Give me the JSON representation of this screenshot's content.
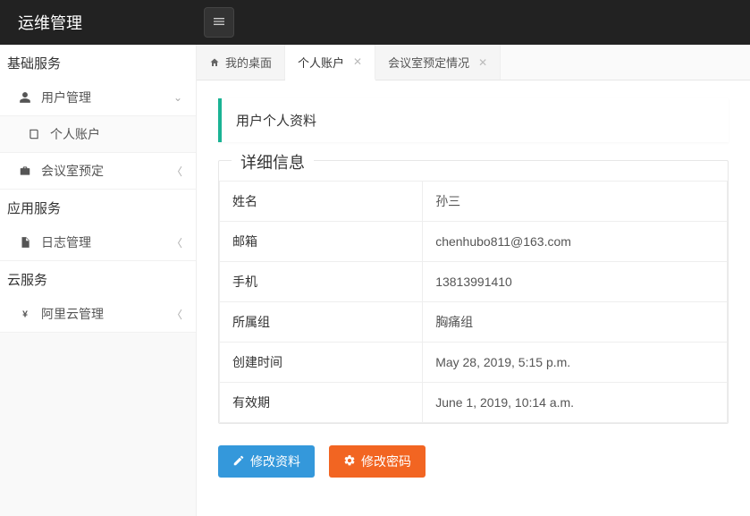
{
  "brand": "运维管理",
  "sidebar": {
    "groups": [
      {
        "header": "基础服务",
        "items": [
          {
            "icon": "user",
            "label": "用户管理",
            "chev": "down",
            "children": [
              {
                "icon": "book",
                "label": "个人账户"
              }
            ]
          },
          {
            "icon": "briefcase",
            "label": "会议室预定",
            "chev": "left"
          }
        ]
      },
      {
        "header": "应用服务",
        "items": [
          {
            "icon": "file",
            "label": "日志管理",
            "chev": "left"
          }
        ]
      },
      {
        "header": "云服务",
        "items": [
          {
            "icon": "yen",
            "label": "阿里云管理",
            "chev": "left"
          }
        ]
      }
    ]
  },
  "tabs": [
    {
      "icon": "home",
      "label": "我的桌面",
      "closable": false,
      "active": false
    },
    {
      "label": "个人账户",
      "closable": true,
      "active": true
    },
    {
      "label": "会议室预定情况",
      "closable": true,
      "active": false
    }
  ],
  "panel": {
    "title": "用户个人资料",
    "section_title": "详细信息",
    "rows": [
      {
        "key": "姓名",
        "value": "孙三"
      },
      {
        "key": "邮箱",
        "value": "chenhubo811@163.com"
      },
      {
        "key": "手机",
        "value": "13813991410"
      },
      {
        "key": "所属组",
        "value": "胸痛组"
      },
      {
        "key": "创建时间",
        "value": "May 28, 2019, 5:15 p.m."
      },
      {
        "key": "有效期",
        "value": "June 1, 2019, 10:14 a.m."
      }
    ],
    "buttons": {
      "edit_profile": "修改资料",
      "edit_password": "修改密码"
    }
  }
}
